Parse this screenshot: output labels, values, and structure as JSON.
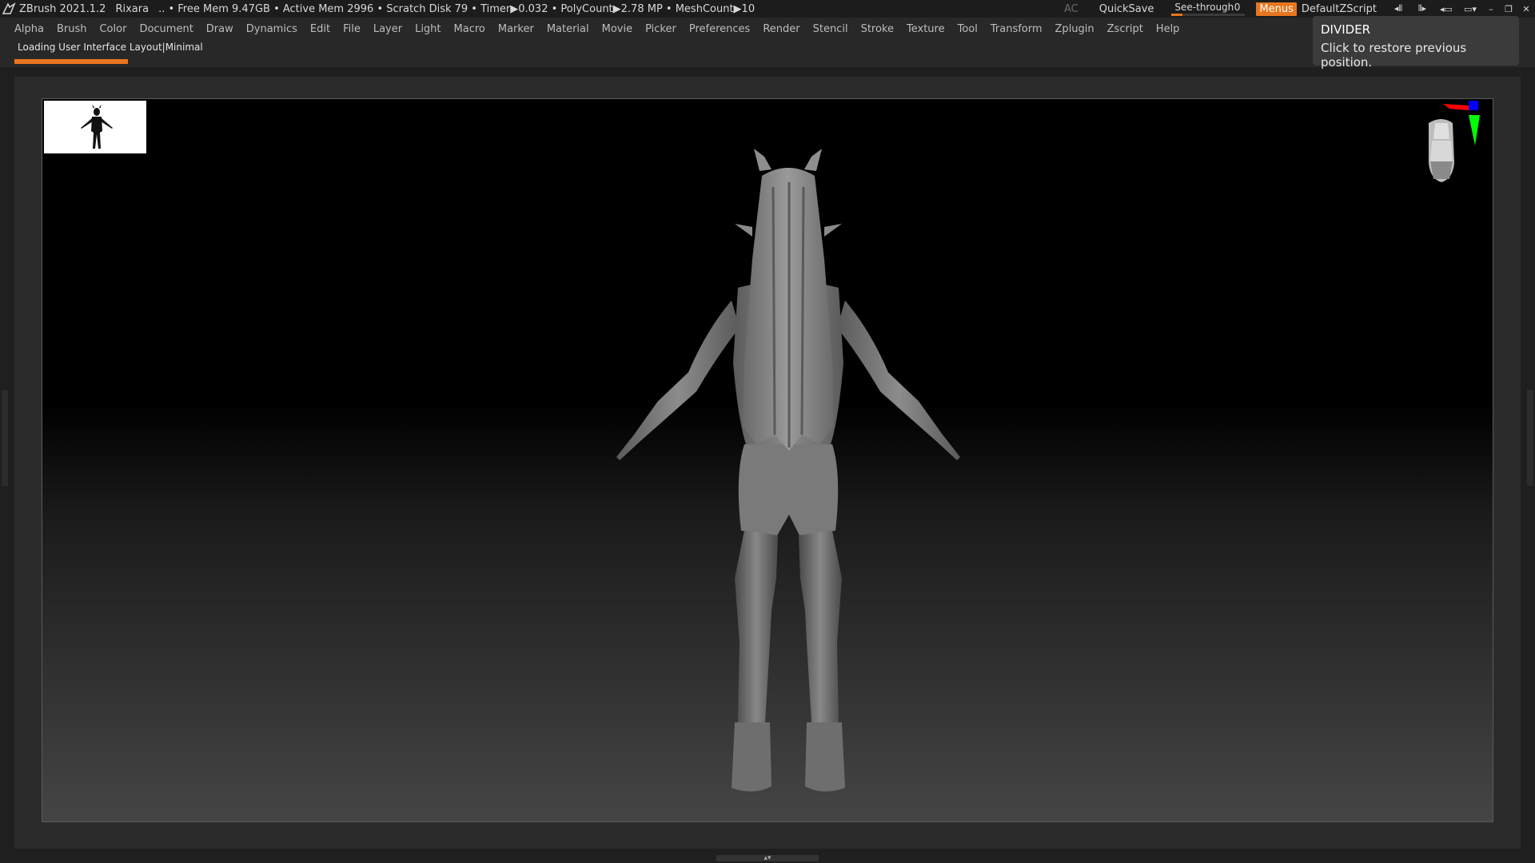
{
  "titlebar": {
    "app": "ZBrush 2021.1.2",
    "project": "Rixara",
    "stats": ".. • Free Mem 9.47GB • Active Mem 2996 • Scratch Disk 79 • Timer▶0.032 • PolyCount▶2.78 MP • MeshCount▶10",
    "ac_label": "AC",
    "quicksave_label": "QuickSave",
    "seethrough_label": "See-through",
    "seethrough_value": "0",
    "seethrough_level": 0.0,
    "menus_label": "Menus",
    "zscript_name": "DefaultZScript"
  },
  "menubar": {
    "items": [
      "Alpha",
      "Brush",
      "Color",
      "Document",
      "Draw",
      "Dynamics",
      "Edit",
      "File",
      "Layer",
      "Light",
      "Macro",
      "Marker",
      "Material",
      "Movie",
      "Picker",
      "Preferences",
      "Render",
      "Stencil",
      "Stroke",
      "Texture",
      "Tool",
      "Transform",
      "Zplugin",
      "Zscript",
      "Help"
    ]
  },
  "status": {
    "text": "Loading User Interface Layout|Minimal",
    "progress": 0.16
  },
  "tooltip": {
    "title": "DIVIDER",
    "body": "Click to restore previous position."
  },
  "colors": {
    "accent": "#e8761e",
    "axis_x": "#ff0000",
    "axis_y": "#00ff00",
    "axis_z": "#0000ff"
  },
  "icons": {
    "logo": "zbrush-logo-icon",
    "navcube": "navigation-head-icon",
    "thumbnail": "figure-silhouette-icon"
  }
}
